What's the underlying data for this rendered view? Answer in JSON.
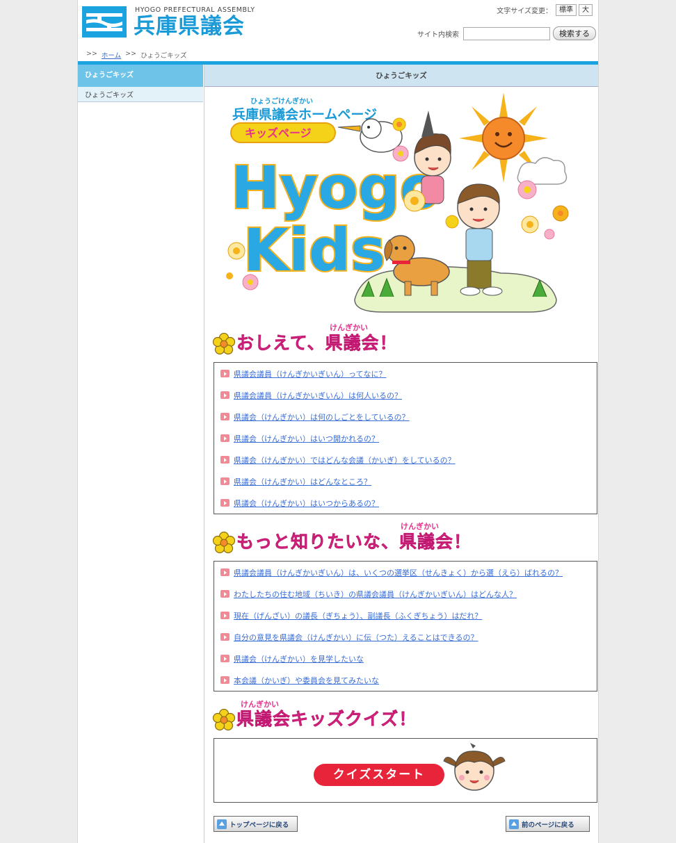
{
  "header": {
    "logo_en": "HYOGO PREFECTURAL ASSEMBLY",
    "logo_jp": "兵庫県議会",
    "font_size_label": "文字サイズ変更：",
    "font_size_normal": "標準",
    "font_size_large": "大",
    "search_label": "サイト内検索",
    "search_placeholder": "",
    "search_button": "検索する"
  },
  "breadcrumb": {
    "sep1": ">>",
    "home": "ホーム",
    "sep2": ">>",
    "current": "ひょうごキッズ"
  },
  "sidebar": {
    "heading": "ひょうごキッズ",
    "items": [
      {
        "label": "ひょうごキッズ"
      }
    ]
  },
  "main": {
    "heading": "ひょうごキッズ",
    "hero": {
      "ruby": "ひょうごけんぎかい",
      "title": "兵庫県議会ホームページ",
      "badge": "キッズページ",
      "logo_line1": "Hyogo",
      "logo_line2": "Kids"
    },
    "section1": {
      "ruby": "けんぎかい",
      "title": "おしえて、県議会！",
      "items": [
        "県議会議員（けんぎかいぎいん）ってなに？",
        "県議会議員（けんぎかいぎいん）は何人いるの？",
        "県議会（けんぎかい）は何のしごとをしているの？",
        "県議会（けんぎかい）はいつ開かれるの？",
        "県議会（けんぎかい）ではどんな会議（かいぎ）をしているの？",
        "県議会（けんぎかい）はどんなところ？",
        "県議会（けんぎかい）はいつからあるの？"
      ]
    },
    "section2": {
      "ruby": "けんぎかい",
      "title": "もっと知りたいな、県議会！",
      "items": [
        "県議会議員（けんぎかいぎいん）は、いくつの選挙区（せんきょく）から選（えら）ばれるの？",
        "わたしたちの住む地域（ちいき）の県議会議員（けんぎかいぎいん）はどんな人？",
        "現在（げんざい）の議長（ぎちょう）、副議長（ふくぎちょう）はだれ？",
        "自分の意見を県議会（けんぎかい）に伝（つた）えることはできるの？",
        "県議会（けんぎかい）を見学したいな",
        "本会議（かいぎ）や委員会を見てみたいな"
      ]
    },
    "section3": {
      "ruby": "けんぎかい",
      "title": "県議会キッズクイズ！",
      "start_button": "クイズスタート"
    },
    "nav": {
      "top_page": "トップページに戻る",
      "prev_page": "前のページに戻る"
    }
  },
  "colors": {
    "accent_blue": "#1aa3de",
    "pink": "#e8308c",
    "link": "#3a6ed6",
    "quiz_red": "#e8243a"
  }
}
